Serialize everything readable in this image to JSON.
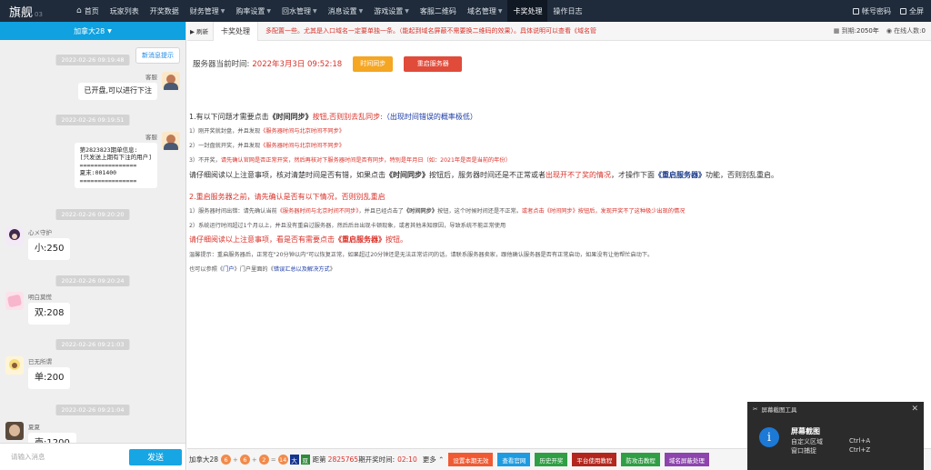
{
  "app": {
    "logo": "旗舰",
    "version": "03"
  },
  "nav": {
    "items": [
      {
        "label": "首页",
        "dropdown": false,
        "active": false,
        "home": true
      },
      {
        "label": "玩家列表",
        "dropdown": false,
        "active": false
      },
      {
        "label": "开奖数据",
        "dropdown": false,
        "active": false
      },
      {
        "label": "财务管理",
        "dropdown": true,
        "active": false
      },
      {
        "label": "购率设置",
        "dropdown": true,
        "active": false
      },
      {
        "label": "回水管理",
        "dropdown": true,
        "active": false
      },
      {
        "label": "消息设置",
        "dropdown": true,
        "active": false
      },
      {
        "label": "游戏设置",
        "dropdown": true,
        "active": false
      },
      {
        "label": "客服二维码",
        "dropdown": false,
        "active": false
      },
      {
        "label": "域名管理",
        "dropdown": true,
        "active": false
      },
      {
        "label": "卡奖处理",
        "dropdown": false,
        "active": true
      },
      {
        "label": "操作日志",
        "dropdown": false,
        "active": false
      }
    ],
    "right": {
      "password": "帐号密码",
      "fullscreen": "全屏"
    }
  },
  "chat": {
    "room": "加拿大28",
    "new_msg_tip": "新消息提示",
    "messages": [
      {
        "time": "2022-02-26 09:19:48",
        "side": "right",
        "sender": "客服",
        "text": "已开盘,可以进行下注"
      },
      {
        "time": "2022-02-26 09:19:51",
        "side": "right",
        "sender": "客服",
        "text": "第2823823期单信息:\n[只发送上期有下注的用户]\n================\n夏末:001400\n================"
      },
      {
        "time": "2022-02-26 09:20:20",
        "side": "left",
        "sender": "心メ守护",
        "text": "小:250"
      },
      {
        "time": "2022-02-26 09:20:24",
        "side": "left",
        "sender": "明白莫慌",
        "text": "双:208"
      },
      {
        "time": "2022-02-26 09:21:03",
        "side": "left",
        "sender": "已无所谓",
        "text": "单:200"
      },
      {
        "time": "2022-02-26 09:21:04",
        "side": "left",
        "sender": "夏夏",
        "text": "売:1200"
      }
    ],
    "input_placeholder": "请输入消息",
    "send_label": "发送"
  },
  "tabs": {
    "ctrl": "▶ 刷新",
    "active_tab": "卡奖处理",
    "marquee": "多配置一些。尤其是入口域名一定要单独一条。（能起到域名屏蔽不需要换二维码的效果）。具体说明可以查看《域名管",
    "expire_label": "到期:",
    "expire_value": "2050年",
    "online_label": "在线人数",
    "online_value": "0"
  },
  "content": {
    "server_time_label": "服务器当前时间:",
    "server_time_value": "2022年3月3日 09:52:18",
    "sync_btn": "时间同步",
    "restart_btn": "重启服务器",
    "s1_title_a": "1.有以下问题才需要点击",
    "s1_title_b": "《时间同步》",
    "s1_title_c": "按钮,否则别去乱同步:",
    "s1_title_d": "（出现时间错误的概率极低）",
    "s1_l1_a": "1）刚开奖就封盘，并且发现",
    "s1_l1_b": "《服务器时间与北京时间不同步》",
    "s1_l2_a": "2）一封盘就开奖，并且发现",
    "s1_l2_b": "《服务器时间与北京时间不同步》",
    "s1_l3_a": "3）不开奖，",
    "s1_l3_b": "请先确认官网是否正常开奖，然后再核对下服务器时间是否有同步，特别是年月日（如：2021年是否是当前的年份）",
    "s1_note_a": "请仔细阅读以上注意事项，核对清楚时间是否有错，如果点击",
    "s1_note_b": "《时间同步》",
    "s1_note_c": "按钮后，服务器时间还是不正常或者",
    "s1_note_d": "出现开不了奖的情况",
    "s1_note_e": "，才操作下面",
    "s1_note_f": "《重启服务器》",
    "s1_note_g": "功能，否则别乱重启。",
    "s2_title": "2.重启服务器之前，请先确认是否有以下情况，否则别乱重启",
    "s2_l1_a": "1）服务器时间出错：请先确认当前",
    "s2_l1_b": "《服务器时间与北京时间不同步》",
    "s2_l1_c": "，并且已经点击了",
    "s2_l1_d": "《时间同步》",
    "s2_l1_e": "按钮，这个时候时间还是不正常。",
    "s2_l1_f": "或者点击《时间同步》按钮后，发现开奖不了这种极少出现的情况",
    "s2_l2": "2）系统运行时间超过1个月以上，并且没有重启过服务器，然后后台出现卡顿现象，或者其他未知原因，导致系统不能正常使用",
    "s2_note_a": "请仔细阅读以上注意事项，看是否有需要点击",
    "s2_note_b": "《重启服务器》",
    "s2_note_c": "按钮。",
    "tip": "温馨提示：重启服务器后，正常在\"20分钟以内\"可以恢复正常，如果超过20分钟还是无法正常访问的话，请联系服务器卖家，跟他确认服务器是否有正常启动，如果没有让他帮忙启动下。",
    "ref_a": "也可以参照《",
    "ref_b": "门户",
    "ref_c": "》门户里面的《",
    "ref_d": "错误汇总以及解决方式",
    "ref_e": "》"
  },
  "bottom": {
    "game": "加拿大28",
    "balls": [
      "6",
      "6",
      "2",
      "14"
    ],
    "ops": [
      "+",
      "+",
      "="
    ],
    "tag1": "大",
    "tag2": "双",
    "gap_label": "距第",
    "period": "2825765",
    "period_suffix": "期开奖时间:",
    "countdown": "02:10",
    "more": "更多",
    "buttons": [
      {
        "label": "设置本期无效",
        "color": "#f05a33"
      },
      {
        "label": "查看官网",
        "color": "#1e9be0"
      },
      {
        "label": "历史开奖",
        "color": "#2f9e44"
      },
      {
        "label": "平台使用教程",
        "color": "#b3261e"
      },
      {
        "label": "防攻击教程",
        "color": "#2f9e44"
      },
      {
        "label": "域名屏蔽处理",
        "color": "#8e44ad"
      }
    ]
  },
  "popup": {
    "title": "屏幕截图工具",
    "heading": "屏幕截图",
    "row1": "自定义区域",
    "key1": "Ctrl+A",
    "row2": "窗口捕捉",
    "key2": "Ctrl+Z"
  }
}
